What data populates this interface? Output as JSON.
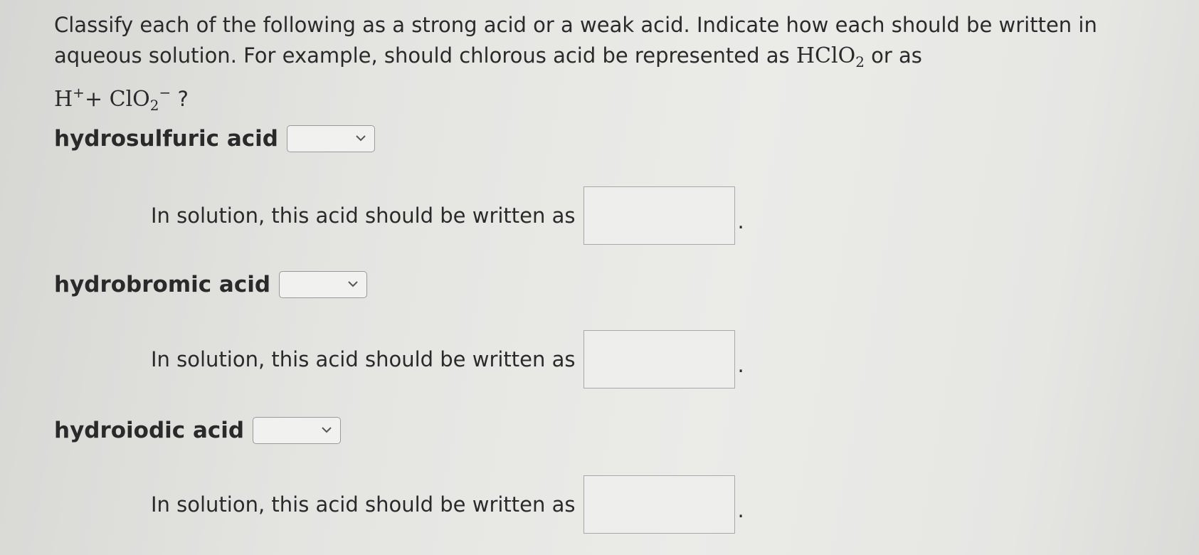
{
  "question": {
    "text_1": "Classify each of the following as a strong acid or a weak acid. Indicate how each should be written in aqueous solution. For example, should chlorous acid be represented as ",
    "formula_1_base": "HClO",
    "formula_1_sub": "2",
    "text_2": " or as",
    "formula_2_h": "H",
    "formula_2_h_sup": "+",
    "formula_2_plus": "+ ClO",
    "formula_2_sub": "2",
    "formula_2_sup": "−",
    "text_3": "?"
  },
  "acids": [
    {
      "label": "hydrosulfuric acid",
      "selected": "",
      "solution_label": "In solution, this acid should be written as",
      "answer": "",
      "period": "."
    },
    {
      "label": "hydrobromic acid",
      "selected": "",
      "solution_label": "In solution, this acid should be written as",
      "answer": "",
      "period": "."
    },
    {
      "label": "hydroiodic acid",
      "selected": "",
      "solution_label": "In solution, this acid should be written as",
      "answer": "",
      "period": "."
    }
  ],
  "icons": {
    "dropdown": "chevron-down-icon"
  }
}
